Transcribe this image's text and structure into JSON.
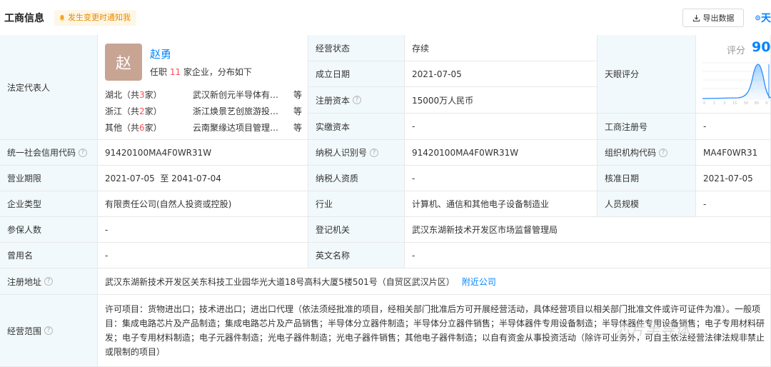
{
  "header": {
    "title": "工商信息",
    "notify_label": "发生变更时通知我",
    "export_label": "导出数据",
    "logo_text": "天"
  },
  "rep": {
    "label": "法定代表人",
    "avatar_char": "赵",
    "name": "赵勇",
    "sub_prefix": "任职 ",
    "sub_count": "11",
    "sub_suffix": " 家企业，分布如下",
    "regions": [
      {
        "name": "湖北（共",
        "count": "3",
        "end": "家）",
        "company": "武汉新创元半导体有…",
        "deng": "等"
      },
      {
        "name": "浙江（共",
        "count": "2",
        "end": "家）",
        "company": "浙江焕景艺创旅游投…",
        "deng": "等"
      },
      {
        "name": "其他（共",
        "count": "6",
        "end": "家）",
        "company": "云南聚缘达项目管理…",
        "deng": "等"
      }
    ]
  },
  "fields": {
    "status_label": "经营状态",
    "status_value": "存续",
    "found_label": "成立日期",
    "found_value": "2021-07-05",
    "capital_label": "注册资本",
    "capital_value": "15000万人民币",
    "paid_label": "实缴资本",
    "paid_value": "-",
    "tianyan_label": "天眼评分",
    "reg_no_label": "工商注册号",
    "reg_no_value": "-",
    "credit_label": "统一社会信用代码",
    "credit_value": "91420100MA4F0WR31W",
    "taxid_label": "纳税人识别号",
    "taxid_value": "91420100MA4F0WR31W",
    "org_label": "组织机构代码",
    "org_value": "MA4F0WR31",
    "term_label": "营业期限",
    "term_value": "2021-07-05  至 2041-07-04",
    "taxq_label": "纳税人资质",
    "taxq_value": "-",
    "approve_label": "核准日期",
    "approve_value": "2021-07-05",
    "type_label": "企业类型",
    "type_value": "有限责任公司(自然人投资或控股)",
    "industry_label": "行业",
    "industry_value": "计算机、通信和其他电子设备制造业",
    "staff_label": "人员规模",
    "staff_value": "-",
    "insured_label": "参保人数",
    "insured_value": "-",
    "regorg_label": "登记机关",
    "regorg_value": "武汉东湖新技术开发区市场监督管理局",
    "former_label": "曾用名",
    "former_value": "-",
    "english_label": "英文名称",
    "english_value": "-",
    "address_label": "注册地址",
    "address_value": "武汉东湖新技术开发区关东科技工业园华光大道18号高科大厦5楼501号（自贸区武汉片区）",
    "nearby_label": "附近公司",
    "scope_label": "经营范围",
    "scope_value": "许可项目：货物进出口；技术进出口；进出口代理（依法须经批准的项目，经相关部门批准后方可开展经营活动，具体经营项目以相关部门批准文件或许可证件为准）。一般项目：集成电路芯片及产品制造；集成电路芯片及产品销售；半导体分立器件制造；半导体分立器件销售；半导体器件专用设备制造；半导体器件专用设备销售；电子专用材料研发；电子专用材料制造；电子元器件制造；光电子器件制造；光电子器件销售；其他电子器件制造；以自有资金从事投资活动（除许可业务外，可自主依法经营法律法规非禁止或限制的项目）"
  },
  "score": {
    "label": "评分",
    "value": "90",
    "axis_ticks": [
      "0",
      "1",
      "3",
      "15",
      "50",
      "85",
      "9"
    ]
  },
  "watermark": "芯片半导体"
}
